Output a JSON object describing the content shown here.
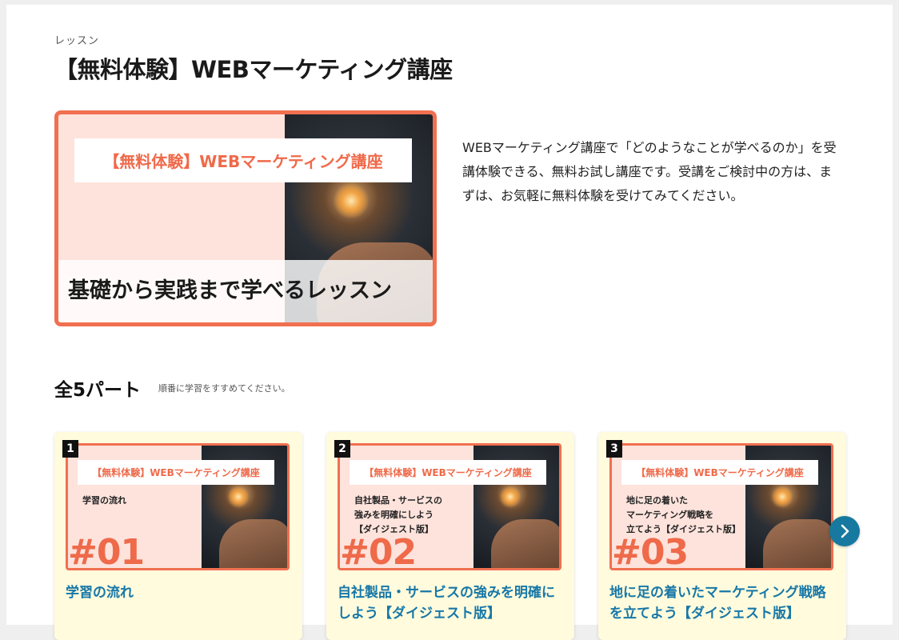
{
  "lesson": {
    "eyebrow": "レッスン",
    "title": "【無料体験】WEBマーケティング講座",
    "hero": {
      "label": "【無料体験】WEBマーケティング講座",
      "band": "基礎から実践まで学べるレッスン"
    },
    "description": "WEBマーケティング講座で「どのようなことが学べるのか」を受講体験できる、無料お試し講座です。受講をご検討中の方は、まずは、お気軽に無料体験を受けてみてください。"
  },
  "parts": {
    "heading": "全5パート",
    "note": "順番に学習をすすめてください。",
    "cards": [
      {
        "number": "1",
        "thumb_label": "【無料体験】WEBマーケティング講座",
        "thumb_sub": "学習の流れ",
        "thumb_big": "#01",
        "title": "学習の流れ"
      },
      {
        "number": "2",
        "thumb_label": "【無料体験】WEBマーケティング講座",
        "thumb_sub": "自社製品・サービスの\n強みを明確にしよう\n【ダイジェスト版】",
        "thumb_big": "#02",
        "title": "自社製品・サービスの強みを明確にしよう【ダイジェスト版】"
      },
      {
        "number": "3",
        "thumb_label": "【無料体験】WEBマーケティング講座",
        "thumb_sub": "地に足の着いた\nマーケティング戦略を\n立てよう【ダイジェスト版】",
        "thumb_big": "#03",
        "title": "地に足の着いたマーケティング戦略を立てよう【ダイジェスト版】"
      }
    ]
  },
  "colors": {
    "accent": "#f07050",
    "link": "#1777a8",
    "card_bg": "#fffbdc",
    "arrow": "#17799f"
  },
  "icons": {
    "next": "chevron-right-icon"
  }
}
